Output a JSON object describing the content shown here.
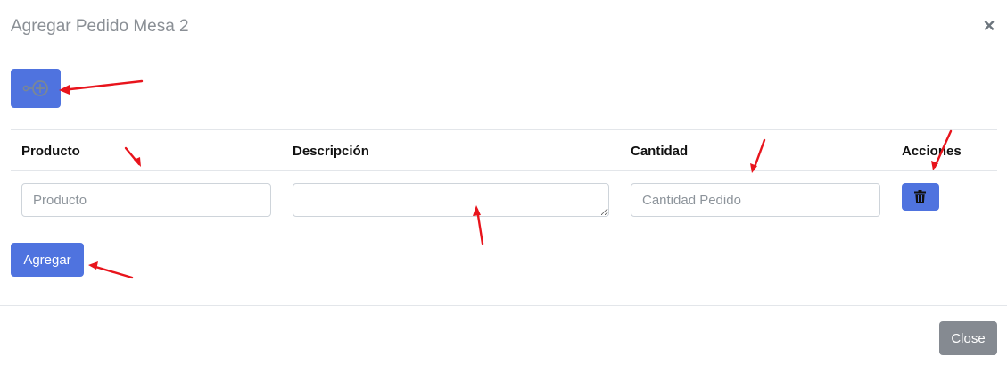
{
  "modal": {
    "title": "Agregar Pedido Mesa 2",
    "close_symbol": "×"
  },
  "toolbar": {
    "add_row_icon": "link-plus-icon"
  },
  "table": {
    "headers": {
      "producto": "Producto",
      "descripcion": "Descripción",
      "cantidad": "Cantidad",
      "acciones": "Acciones"
    },
    "row": {
      "producto_placeholder": "Producto",
      "producto_value": "",
      "descripcion_value": "",
      "cantidad_placeholder": "Cantidad Pedido",
      "cantidad_value": "",
      "delete_icon": "trash-icon"
    }
  },
  "actions": {
    "agregar_label": "Agregar"
  },
  "footer": {
    "close_label": "Close"
  },
  "colors": {
    "primary": "#4f73df",
    "secondary": "#858a91",
    "annotation_arrow": "#e8141c"
  }
}
